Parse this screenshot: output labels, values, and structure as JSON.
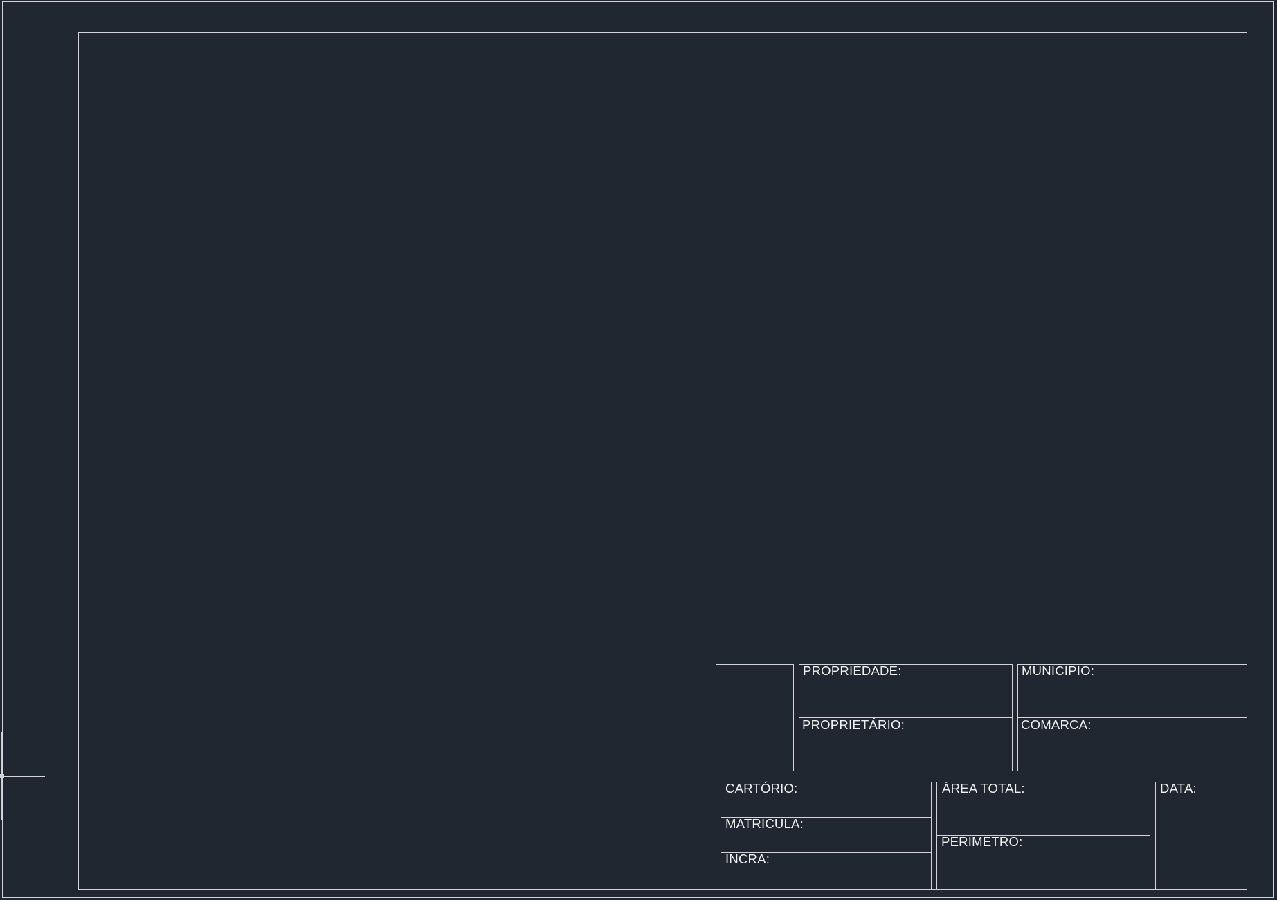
{
  "title_block": {
    "propriedade": "PROPRIEDADE:",
    "proprietario": "PROPRIETÁRIO:",
    "municipio": "MUNICIPIO:",
    "comarca": "COMARCA:",
    "cartorio": "CARTÓRIO:",
    "matricula": "MATRICULA:",
    "incra": "INCRA:",
    "area_total": "ÁREA TOTAL:",
    "perimetro": "PERIMETRO:",
    "data": "DATA:"
  },
  "colors": {
    "background": "#212730",
    "line": "#cfd5db",
    "text": "#eef1f3"
  }
}
